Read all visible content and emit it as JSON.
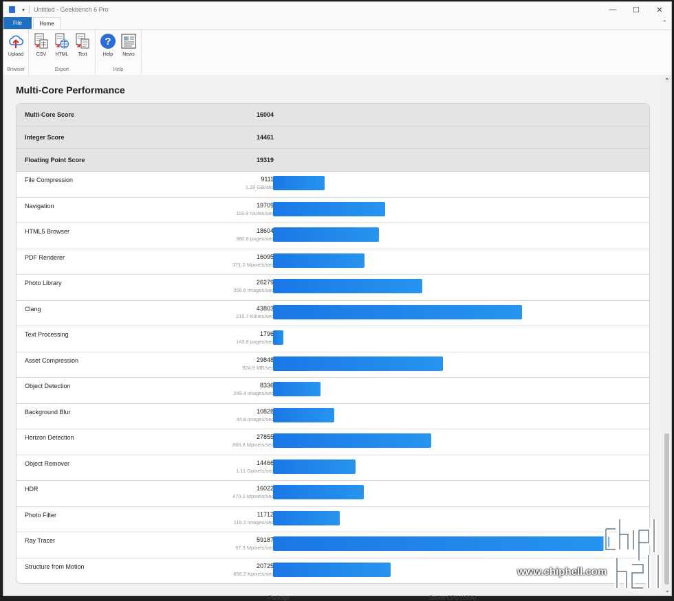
{
  "window": {
    "title": "Untitled - Geekbench 6 Pro",
    "qa_glyph": "▾",
    "min": "—",
    "max": "☐",
    "close": "✕"
  },
  "tabs": {
    "file": "File",
    "home": "Home",
    "collapse": "⌃"
  },
  "ribbon": {
    "groups": [
      {
        "label": "Browser",
        "buttons": [
          {
            "label": "Upload",
            "icon": "upload-cloud-icon"
          }
        ]
      },
      {
        "label": "Export",
        "buttons": [
          {
            "label": "CSV",
            "icon": "csv-file-icon"
          },
          {
            "label": "HTML",
            "icon": "html-file-icon"
          },
          {
            "label": "Text",
            "icon": "text-file-icon"
          }
        ]
      },
      {
        "label": "Help",
        "buttons": [
          {
            "label": "Help",
            "icon": "help-icon"
          },
          {
            "label": "News",
            "icon": "news-icon"
          }
        ]
      }
    ]
  },
  "section": {
    "title": "Multi-Core Performance"
  },
  "summary": [
    {
      "label": "Multi-Core Score",
      "value": "16004"
    },
    {
      "label": "Integer Score",
      "value": "14461"
    },
    {
      "label": "Floating Point Score",
      "value": "19319"
    }
  ],
  "bar_max_score": 59187,
  "bar_color": "#1a78e6",
  "benchmarks": [
    {
      "name": "File Compression",
      "score": "9111",
      "score_value": 9111,
      "unit": "1.28 GB/sec"
    },
    {
      "name": "Navigation",
      "score": "19709",
      "score_value": 19709,
      "unit": "118.8 routes/sec"
    },
    {
      "name": "HTML5 Browser",
      "score": "18604",
      "score_value": 18604,
      "unit": "380.9 pages/sec"
    },
    {
      "name": "PDF Renderer",
      "score": "16095",
      "score_value": 16095,
      "unit": "371.2 Mpixels/sec"
    },
    {
      "name": "Photo Library",
      "score": "26279",
      "score_value": 26279,
      "unit": "356.6 images/sec"
    },
    {
      "name": "Clang",
      "score": "43803",
      "score_value": 43803,
      "unit": "215.7 Klines/sec"
    },
    {
      "name": "Text Processing",
      "score": "1796",
      "score_value": 1796,
      "unit": "143.8 pages/sec"
    },
    {
      "name": "Asset Compression",
      "score": "29848",
      "score_value": 29848,
      "unit": "924.9 MB/sec"
    },
    {
      "name": "Object Detection",
      "score": "8336",
      "score_value": 8336,
      "unit": "249.4 images/sec"
    },
    {
      "name": "Background Blur",
      "score": "10828",
      "score_value": 10828,
      "unit": "44.8 images/sec"
    },
    {
      "name": "Horizon Detection",
      "score": "27855",
      "score_value": 27855,
      "unit": "866.8 Mpixels/sec"
    },
    {
      "name": "Object Remover",
      "score": "14466",
      "score_value": 14466,
      "unit": "1.11 Gpixels/sec"
    },
    {
      "name": "HDR",
      "score": "16022",
      "score_value": 16022,
      "unit": "470.2 Mpixels/sec"
    },
    {
      "name": "Photo Filter",
      "score": "11712",
      "score_value": 11712,
      "unit": "116.2 images/sec"
    },
    {
      "name": "Ray Tracer",
      "score": "59187",
      "score_value": 59187,
      "unit": "57.3 Mpixels/sec"
    },
    {
      "name": "Structure from Motion",
      "score": "20725",
      "score_value": 20725,
      "unit": "656.2 Kpixels/sec"
    }
  ],
  "scroll": {
    "up": "⌃",
    "down": "⌄"
  },
  "background_window_text": {
    "left": "Package",
    "right": "Socket CPU (1954)"
  },
  "watermark": {
    "url": "www.chiphell.com"
  }
}
